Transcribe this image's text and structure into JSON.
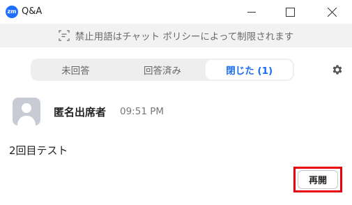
{
  "window": {
    "app_icon_text": "zm",
    "title": "Q&A"
  },
  "banner": {
    "icon": "screen-scan-icon",
    "text": "禁止用語はチャット ポリシーによって制限されます"
  },
  "tabs": [
    {
      "label": "未回答",
      "active": false
    },
    {
      "label": "回答済み",
      "active": false
    },
    {
      "label": "閉じた (1)",
      "active": true
    }
  ],
  "colors": {
    "accent": "#1a6cf0",
    "highlight": "#e8000b",
    "banner_bg": "#f2f2f2",
    "tabs_bg": "#eeeeee"
  },
  "question": {
    "asker": "匿名出席者",
    "time": "09:51 PM",
    "text": "2回目テスト",
    "reopen_label": "再開"
  }
}
